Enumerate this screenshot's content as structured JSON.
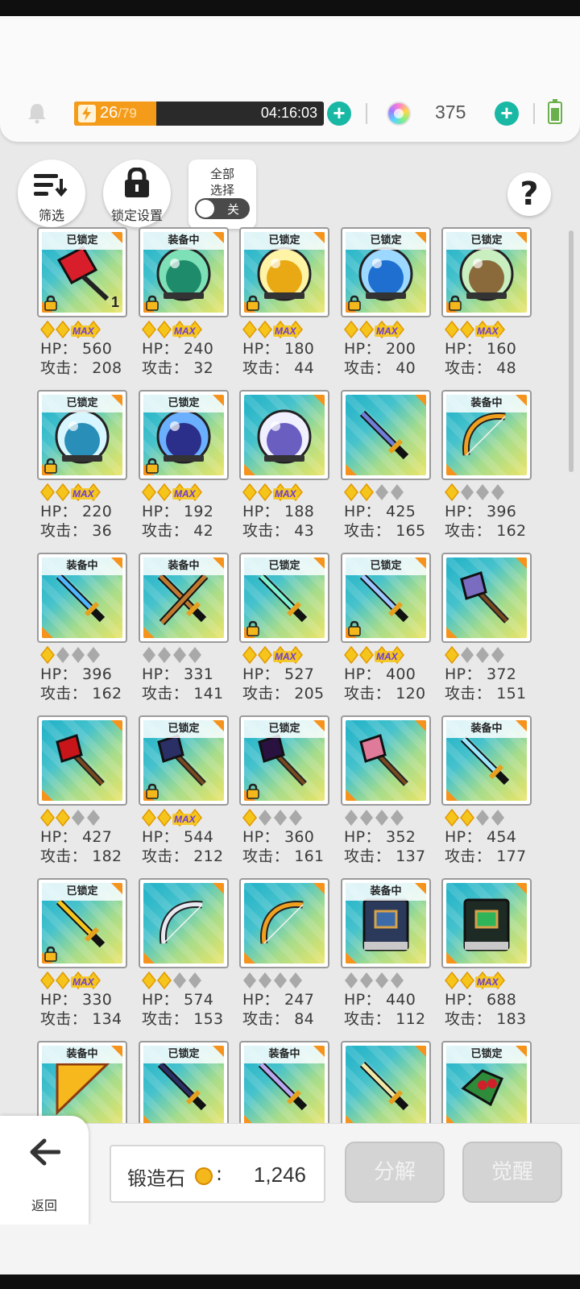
{
  "header": {
    "energy_current": "26",
    "energy_max": "/79",
    "energy_level": 0.33,
    "timer": "04:16:03",
    "gem_count": "375"
  },
  "toolbar": {
    "filter_label": "筛选",
    "lock_settings_label": "锁定设置",
    "select_all_label": "全部\n选择",
    "toggle_label": "关",
    "help_label": "?"
  },
  "items": [
    {
      "status": "已锁定",
      "locked": true,
      "qty": "1",
      "gold": 2,
      "max": true,
      "hp": "HP： 560",
      "atk": "攻击： 208",
      "art": "red-banner-icon"
    },
    {
      "status": "装备中",
      "locked": true,
      "qty": "",
      "gold": 2,
      "max": true,
      "hp": "HP： 240",
      "atk": "攻击： 32",
      "art": "green-orb-icon"
    },
    {
      "status": "已锁定",
      "locked": true,
      "qty": "",
      "gold": 2,
      "max": true,
      "hp": "HP： 180",
      "atk": "攻击： 44",
      "art": "gold-orb-icon"
    },
    {
      "status": "已锁定",
      "locked": true,
      "qty": "",
      "gold": 2,
      "max": true,
      "hp": "HP： 200",
      "atk": "攻击： 40",
      "art": "blue-ship-orb-icon"
    },
    {
      "status": "已锁定",
      "locked": true,
      "qty": "",
      "gold": 2,
      "max": true,
      "hp": "HP： 160",
      "atk": "攻击： 48",
      "art": "earth-orb-icon"
    },
    {
      "status": "已锁定",
      "locked": true,
      "qty": "",
      "gold": 2,
      "max": true,
      "hp": "HP： 220",
      "atk": "攻击： 36",
      "art": "ice-orb-icon"
    },
    {
      "status": "已锁定",
      "locked": true,
      "qty": "",
      "gold": 2,
      "max": true,
      "hp": "HP： 192",
      "atk": "攻击： 42",
      "art": "night-orb-icon"
    },
    {
      "status": "",
      "locked": false,
      "qty": "",
      "gold": 2,
      "max": true,
      "hp": "HP： 188",
      "atk": "攻击： 43",
      "art": "crystal-orb-icon"
    },
    {
      "status": "",
      "locked": false,
      "qty": "",
      "gold": 2,
      "max": false,
      "hp": "HP： 425",
      "atk": "攻击： 165",
      "art": "sword-icon"
    },
    {
      "status": "装备中",
      "locked": false,
      "qty": "",
      "gold": 1,
      "max": false,
      "hp": "HP： 396",
      "atk": "攻击： 162",
      "art": "rainbow-sword-icon"
    },
    {
      "status": "装备中",
      "locked": false,
      "qty": "",
      "gold": 1,
      "max": false,
      "hp": "HP： 396",
      "atk": "攻击： 162",
      "art": "blue-sword-icon"
    },
    {
      "status": "装备中",
      "locked": false,
      "qty": "",
      "gold": 0,
      "max": false,
      "hp": "HP： 331",
      "atk": "攻击： 141",
      "art": "crossed-swords-icon"
    },
    {
      "status": "已锁定",
      "locked": true,
      "qty": "",
      "gold": 2,
      "max": true,
      "hp": "HP： 527",
      "atk": "攻击： 205",
      "art": "jewel-sword-icon"
    },
    {
      "status": "已锁定",
      "locked": true,
      "qty": "",
      "gold": 2,
      "max": true,
      "hp": "HP： 400",
      "atk": "攻击： 120",
      "art": "curved-sword-icon"
    },
    {
      "status": "",
      "locked": false,
      "qty": "",
      "gold": 1,
      "max": false,
      "hp": "HP： 372",
      "atk": "攻击： 151",
      "art": "battle-axe-icon"
    },
    {
      "status": "",
      "locked": false,
      "qty": "",
      "gold": 2,
      "max": false,
      "hp": "HP： 427",
      "atk": "攻击： 182",
      "art": "hammer-icon"
    },
    {
      "status": "已锁定",
      "locked": true,
      "qty": "",
      "gold": 2,
      "max": true,
      "hp": "HP： 544",
      "atk": "攻击： 212",
      "art": "dark-axe-icon"
    },
    {
      "status": "已锁定",
      "locked": true,
      "qty": "",
      "gold": 1,
      "max": false,
      "hp": "HP： 360",
      "atk": "攻击： 161",
      "art": "scythe-icon"
    },
    {
      "status": "",
      "locked": false,
      "qty": "",
      "gold": 0,
      "max": false,
      "hp": "HP： 352",
      "atk": "攻击： 137",
      "art": "pink-axe-icon"
    },
    {
      "status": "装备中",
      "locked": false,
      "qty": "",
      "gold": 2,
      "max": false,
      "hp": "HP： 454",
      "atk": "攻击： 177",
      "art": "ice-spear-icon"
    },
    {
      "status": "已锁定",
      "locked": true,
      "qty": "",
      "gold": 2,
      "max": true,
      "hp": "HP： 330",
      "atk": "攻击： 134",
      "art": "golden-trident-icon"
    },
    {
      "status": "",
      "locked": false,
      "qty": "",
      "gold": 2,
      "max": false,
      "hp": "HP： 574",
      "atk": "攻击： 153",
      "art": "white-bow-icon"
    },
    {
      "status": "",
      "locked": false,
      "qty": "",
      "gold": 0,
      "max": false,
      "hp": "HP： 247",
      "atk": "攻击： 84",
      "art": "fire-bow-icon"
    },
    {
      "status": "装备中",
      "locked": false,
      "qty": "",
      "gold": 0,
      "max": false,
      "hp": "HP： 440",
      "atk": "攻击： 112",
      "art": "blue-book-icon"
    },
    {
      "status": "",
      "locked": false,
      "qty": "",
      "gold": 2,
      "max": true,
      "hp": "HP： 688",
      "atk": "攻击： 183",
      "art": "emerald-book-icon"
    },
    {
      "status": "装备中",
      "locked": false,
      "qty": "",
      "gold": 0,
      "max": false,
      "hp": "",
      "atk": "",
      "art": "golden-fan-icon"
    },
    {
      "status": "已锁定",
      "locked": false,
      "qty": "",
      "gold": 0,
      "max": false,
      "hp": "",
      "atk": "",
      "art": "dark-sword-icon"
    },
    {
      "status": "装备中",
      "locked": false,
      "qty": "",
      "gold": 0,
      "max": false,
      "hp": "",
      "atk": "",
      "art": "spear-icon"
    },
    {
      "status": "",
      "locked": false,
      "qty": "",
      "gold": 0,
      "max": false,
      "hp": "",
      "atk": "",
      "art": "staff-icon"
    },
    {
      "status": "已锁定",
      "locked": false,
      "qty": "",
      "gold": 0,
      "max": false,
      "hp": "",
      "atk": "",
      "art": "holly-icon"
    }
  ],
  "max_badge": "MAX",
  "footer": {
    "back_label": "返回",
    "stone_label": "锻造石",
    "stone_colon": ":",
    "stone_value": "1,246",
    "decompose_label": "分解",
    "awaken_label": "觉醒"
  },
  "colors": {
    "accent_teal": "#19b8a5",
    "energy_orange": "#f59b1a",
    "star_gold": "#f6c51c",
    "star_gray": "#a9a9a9"
  }
}
